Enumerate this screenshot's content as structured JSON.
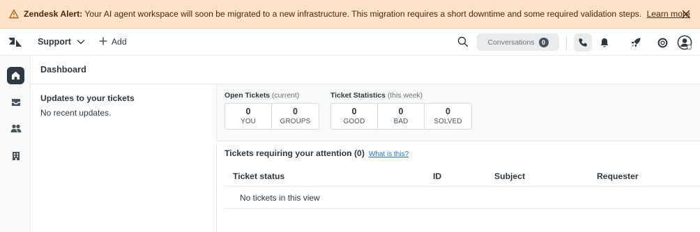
{
  "alert": {
    "title": "Zendesk Alert:",
    "message": "Your AI agent workspace will soon be migrated to a new infrastructure. This migration requires a short downtime and some required validation steps.",
    "link": "Learn more",
    "icon": "warning-icon",
    "close_icon": "close-icon"
  },
  "header": {
    "logo_icon": "zendesk-logo-icon",
    "product": "Support",
    "add": "Add",
    "conversations_label": "Conversations",
    "conversations_count": "0"
  },
  "nav": {
    "items": [
      "home-icon",
      "views-icon",
      "users-icon",
      "organizations-icon"
    ]
  },
  "dashboard": {
    "title": "Dashboard",
    "updates": {
      "heading": "Updates to your tickets",
      "empty": "No recent updates."
    },
    "open_tickets": {
      "label": "Open Tickets",
      "qualifier": "(current)",
      "stats": [
        {
          "value": "0",
          "caption": "YOU"
        },
        {
          "value": "0",
          "caption": "GROUPS"
        }
      ]
    },
    "ticket_statistics": {
      "label": "Ticket Statistics",
      "qualifier": "(this week)",
      "stats": [
        {
          "value": "0",
          "caption": "GOOD"
        },
        {
          "value": "0",
          "caption": "BAD"
        },
        {
          "value": "0",
          "caption": "SOLVED"
        }
      ]
    },
    "attention": {
      "heading": "Tickets requiring your attention (0)",
      "help_link": "What is this?",
      "columns": [
        "Ticket status",
        "ID",
        "Subject",
        "Requester"
      ],
      "empty": "No tickets in this view"
    }
  },
  "colors": {
    "alert_bg": "#fde2c8",
    "text": "#2f3941",
    "link": "#1f73b7",
    "nav_active": "#2f3941"
  }
}
